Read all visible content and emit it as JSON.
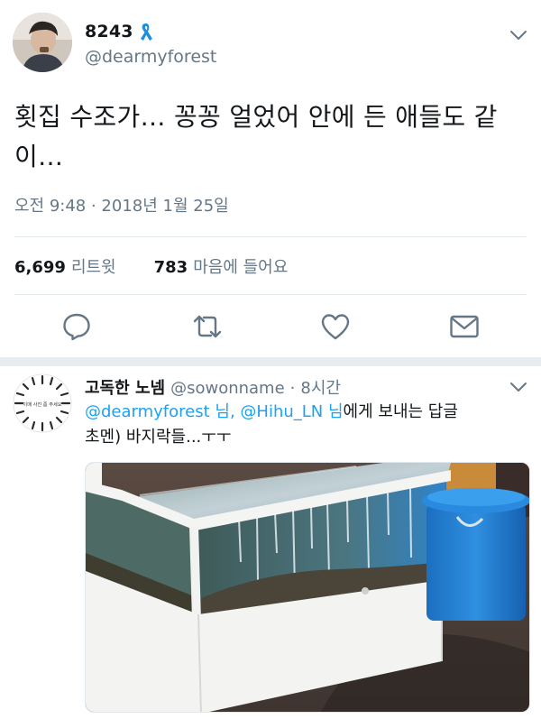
{
  "tweet": {
    "display_name": "8243",
    "handle": "@dearmyforest",
    "text": "횟집 수조가… 꽁꽁 얼었어 안에 든 애들도 같이…",
    "timestamp": "오전 9:48 · 2018년 1월 25일",
    "retweets": {
      "count": "6,699",
      "label": "리트윗"
    },
    "likes": {
      "count": "783",
      "label": "마음에 들어요"
    }
  },
  "actions": [
    {
      "name": "reply",
      "icon": "reply-icon"
    },
    {
      "name": "retweet",
      "icon": "retweet-icon"
    },
    {
      "name": "like",
      "icon": "heart-icon"
    },
    {
      "name": "message",
      "icon": "envelope-icon"
    }
  ],
  "reply": {
    "display_name": "고독한 노넴",
    "handle": "@sowonname",
    "separator": "·",
    "time": "8시간",
    "avatar_text": "이매 사진 좀 주세요",
    "mention_1": "@dearmyforest 님",
    "mention_sep": ", ",
    "mention_2": "@Hihu_LN 님",
    "reply_suffix": "에게 보내는 답글",
    "text": "초멘) 바지락들...ㅜㅜ"
  },
  "colors": {
    "accent": "#1da1f2",
    "secondary_text": "#657786",
    "primary_text": "#14171a",
    "divider": "#e1e8ed"
  }
}
